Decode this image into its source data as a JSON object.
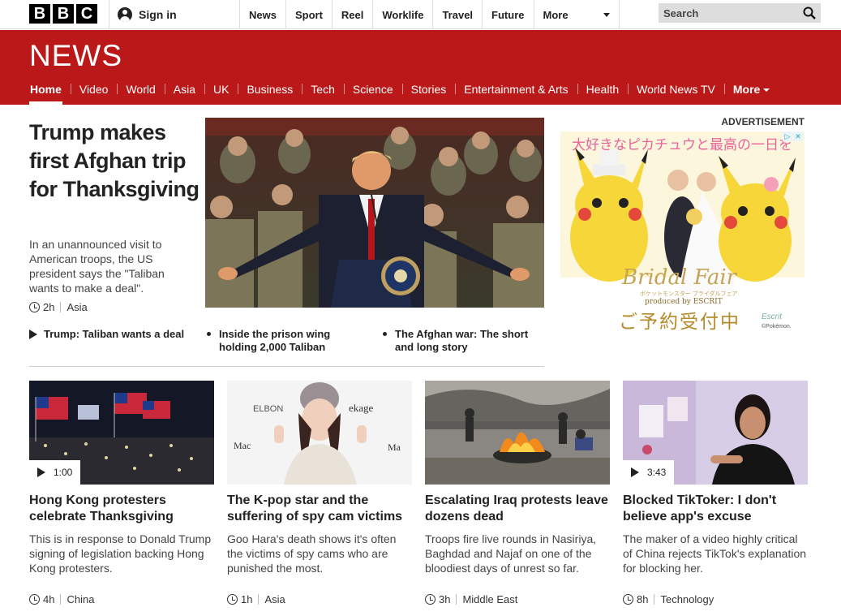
{
  "topbar": {
    "logo_letters": [
      "B",
      "B",
      "C"
    ],
    "sign_in": "Sign in",
    "nav": [
      "News",
      "Sport",
      "Reel",
      "Worklife",
      "Travel",
      "Future"
    ],
    "more": "More",
    "search_placeholder": "Search"
  },
  "banner": {
    "section_title": "NEWS",
    "nav": [
      "Home",
      "Video",
      "World",
      "Asia",
      "UK",
      "Business",
      "Tech",
      "Science",
      "Stories",
      "Entertainment & Arts",
      "Health",
      "World News TV"
    ],
    "more": "More",
    "active": "Home",
    "color": "#bb1919"
  },
  "lead": {
    "headline": "Trump makes first Afghan trip for Thanksgiving",
    "summary": "In an unannounced visit to American troops, the US president says the \"Taliban wants to make a deal\".",
    "time": "2h",
    "section": "Asia",
    "related": [
      {
        "text": "Trump: Taliban wants a deal",
        "icon": "play-icon"
      },
      {
        "text": "Inside the prison wing holding 2,000 Taliban",
        "icon": "bullet"
      },
      {
        "text": "The Afghan war: The short and long story",
        "icon": "bullet"
      }
    ]
  },
  "ad": {
    "label": "ADVERTISEMENT",
    "jp_headline": "大好きなピカチュウと最高の一日を",
    "title": "Bridal Fair",
    "sub1": "ポケットモンスター ブライダルフェア",
    "sub2": "produced by ESCRIT",
    "cta": "ご予約受付中",
    "brand": "Escrit",
    "copyright": "©Pokémon."
  },
  "stories": [
    {
      "headline": "Hong Kong protesters celebrate Thanksgiving",
      "summary": "This is in response to Donald Trump signing of legislation backing Hong Kong protesters.",
      "time": "4h",
      "section": "China",
      "duration": "1:00"
    },
    {
      "headline": "The K-pop star and the suffering of spy cam victims",
      "summary": "Goo Hara's death shows it's often the victims of spy cams who are punished the most.",
      "time": "1h",
      "section": "Asia",
      "duration": null
    },
    {
      "headline": "Escalating Iraq protests leave dozens dead",
      "summary": "Troops fire live rounds in Nasiriya, Baghdad and Najaf on one of the bloodiest days of unrest so far.",
      "time": "3h",
      "section": "Middle East",
      "duration": null
    },
    {
      "headline": "Blocked TikToker: I don't believe app's excuse",
      "summary": "The maker of a video highly critical of China rejects TikTok's explanation for blocking her.",
      "time": "8h",
      "section": "Technology",
      "duration": "3:43"
    }
  ],
  "image_texts": {
    "kpop_backdrop_1": "ELBON",
    "kpop_backdrop_2": "ekage",
    "kpop_backdrop_3": "Mac",
    "kpop_backdrop_4": "Ma"
  }
}
